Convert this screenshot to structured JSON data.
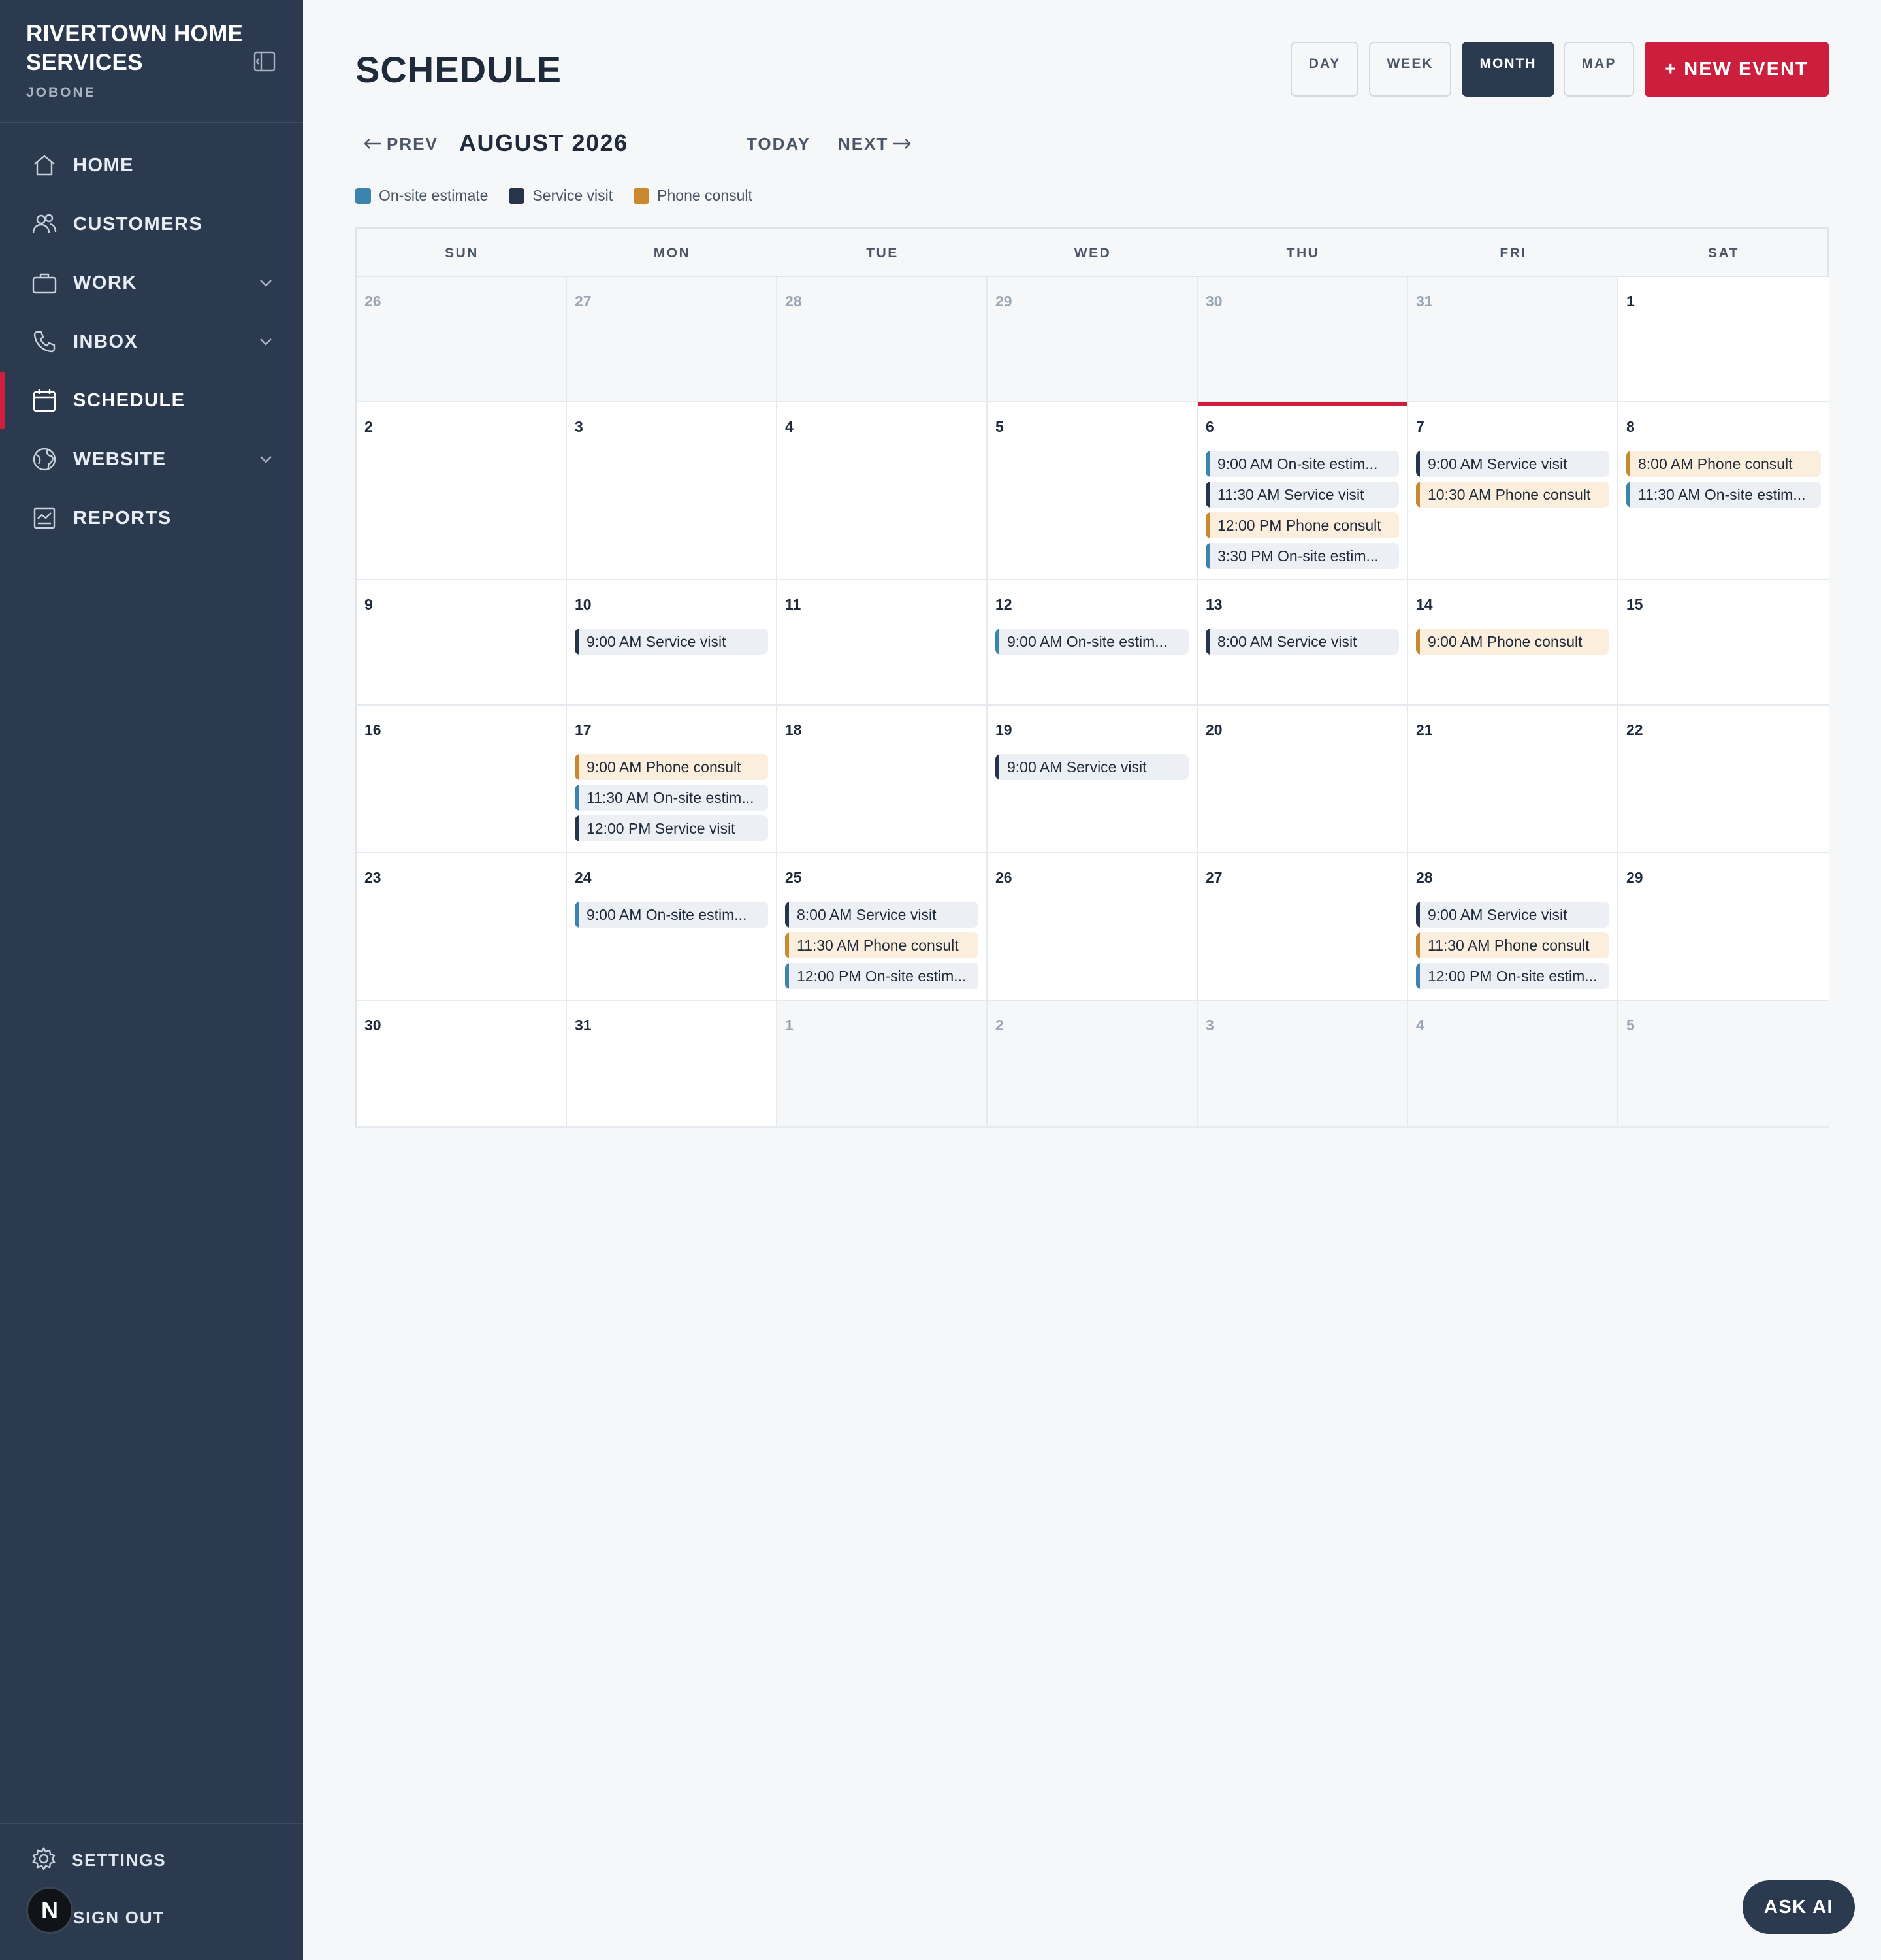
{
  "sidebar": {
    "brand": "RIVERTOWN HOME SERVICES",
    "brand_sub": "JOBONE",
    "items": [
      {
        "label": "HOME",
        "icon": "home-icon"
      },
      {
        "label": "CUSTOMERS",
        "icon": "users-icon"
      },
      {
        "label": "WORK",
        "icon": "briefcase-icon",
        "expandable": true
      },
      {
        "label": "INBOX",
        "icon": "phone-icon",
        "expandable": true
      },
      {
        "label": "SCHEDULE",
        "icon": "calendar-icon",
        "active": true
      },
      {
        "label": "WEBSITE",
        "icon": "globe-icon",
        "expandable": true
      },
      {
        "label": "REPORTS",
        "icon": "reports-icon"
      }
    ],
    "settings_label": "SETTINGS",
    "signout_label": "SIGN OUT",
    "avatar_letter": "N"
  },
  "header": {
    "title": "SCHEDULE",
    "views": [
      "DAY",
      "WEEK",
      "MONTH",
      "MAP"
    ],
    "active_view": "MONTH",
    "new_event_label": "+ NEW EVENT"
  },
  "nav": {
    "prev_label": "PREV",
    "month_label": "AUGUST 2026",
    "today_label": "TODAY",
    "next_label": "NEXT"
  },
  "legend": [
    {
      "label": "On-site estimate",
      "color": "#3a84ad"
    },
    {
      "label": "Service visit",
      "color": "#27354b"
    },
    {
      "label": "Phone consult",
      "color": "#c98a2e"
    }
  ],
  "calendar": {
    "weekdays": [
      "SUN",
      "MON",
      "TUE",
      "WED",
      "THU",
      "FRI",
      "SAT"
    ],
    "today": "6",
    "weeks": [
      [
        {
          "day": "26",
          "other": true,
          "events": []
        },
        {
          "day": "27",
          "other": true,
          "events": []
        },
        {
          "day": "28",
          "other": true,
          "events": []
        },
        {
          "day": "29",
          "other": true,
          "events": []
        },
        {
          "day": "30",
          "other": true,
          "events": []
        },
        {
          "day": "31",
          "other": true,
          "events": []
        },
        {
          "day": "1",
          "events": []
        }
      ],
      [
        {
          "day": "2",
          "events": []
        },
        {
          "day": "3",
          "events": []
        },
        {
          "day": "4",
          "events": []
        },
        {
          "day": "5",
          "events": []
        },
        {
          "day": "6",
          "events": [
            {
              "text": "9:00 AM On-site estim...",
              "type": "onsite"
            },
            {
              "text": "11:30 AM Service visit",
              "type": "service"
            },
            {
              "text": "12:00 PM Phone consult",
              "type": "phone"
            },
            {
              "text": "3:30 PM On-site estim...",
              "type": "onsite"
            }
          ]
        },
        {
          "day": "7",
          "events": [
            {
              "text": "9:00 AM Service visit",
              "type": "service"
            },
            {
              "text": "10:30 AM Phone consult",
              "type": "phone"
            }
          ]
        },
        {
          "day": "8",
          "events": [
            {
              "text": "8:00 AM Phone consult",
              "type": "phone"
            },
            {
              "text": "11:30 AM On-site estim...",
              "type": "onsite"
            }
          ]
        }
      ],
      [
        {
          "day": "9",
          "events": []
        },
        {
          "day": "10",
          "events": [
            {
              "text": "9:00 AM Service visit",
              "type": "service"
            }
          ]
        },
        {
          "day": "11",
          "events": []
        },
        {
          "day": "12",
          "events": [
            {
              "text": "9:00 AM On-site estim...",
              "type": "onsite"
            }
          ]
        },
        {
          "day": "13",
          "events": [
            {
              "text": "8:00 AM Service visit",
              "type": "service"
            }
          ]
        },
        {
          "day": "14",
          "events": [
            {
              "text": "9:00 AM Phone consult",
              "type": "phone"
            }
          ]
        },
        {
          "day": "15",
          "events": []
        }
      ],
      [
        {
          "day": "16",
          "events": []
        },
        {
          "day": "17",
          "events": [
            {
              "text": "9:00 AM Phone consult",
              "type": "phone"
            },
            {
              "text": "11:30 AM On-site estim...",
              "type": "onsite"
            },
            {
              "text": "12:00 PM Service visit",
              "type": "service"
            }
          ]
        },
        {
          "day": "18",
          "events": []
        },
        {
          "day": "19",
          "events": [
            {
              "text": "9:00 AM Service visit",
              "type": "service"
            }
          ]
        },
        {
          "day": "20",
          "events": []
        },
        {
          "day": "21",
          "events": []
        },
        {
          "day": "22",
          "events": []
        }
      ],
      [
        {
          "day": "23",
          "events": []
        },
        {
          "day": "24",
          "events": [
            {
              "text": "9:00 AM On-site estim...",
              "type": "onsite"
            }
          ]
        },
        {
          "day": "25",
          "events": [
            {
              "text": "8:00 AM Service visit",
              "type": "service"
            },
            {
              "text": "11:30 AM Phone consult",
              "type": "phone"
            },
            {
              "text": "12:00 PM On-site estim...",
              "type": "onsite"
            }
          ]
        },
        {
          "day": "26",
          "events": []
        },
        {
          "day": "27",
          "events": []
        },
        {
          "day": "28",
          "events": [
            {
              "text": "9:00 AM Service visit",
              "type": "service"
            },
            {
              "text": "11:30 AM Phone consult",
              "type": "phone"
            },
            {
              "text": "12:00 PM On-site estim...",
              "type": "onsite"
            }
          ]
        },
        {
          "day": "29",
          "events": []
        }
      ],
      [
        {
          "day": "30",
          "events": []
        },
        {
          "day": "31",
          "events": []
        },
        {
          "day": "1",
          "other": true,
          "events": []
        },
        {
          "day": "2",
          "other": true,
          "events": []
        },
        {
          "day": "3",
          "other": true,
          "events": []
        },
        {
          "day": "4",
          "other": true,
          "events": []
        },
        {
          "day": "5",
          "other": true,
          "events": []
        }
      ]
    ]
  },
  "ask_ai_label": "ASK AI"
}
